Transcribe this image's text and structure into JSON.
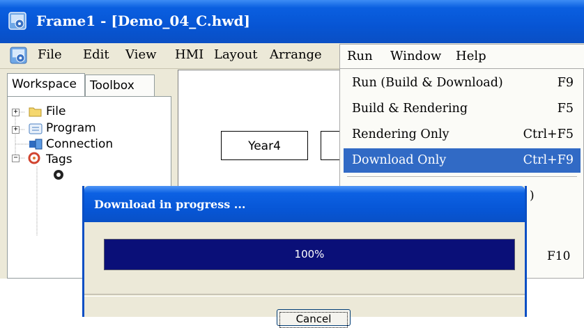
{
  "window": {
    "title": "Frame1 - [Demo_04_C.hwd]"
  },
  "menubar": {
    "items": [
      "File",
      "Edit",
      "View",
      "HMI",
      "Layout",
      "Arrange",
      "Run",
      "Window",
      "Help"
    ]
  },
  "workspace": {
    "tabs": [
      "Workspace",
      "Toolbox"
    ],
    "tree": [
      {
        "label": "File",
        "expander": "+"
      },
      {
        "label": "Program",
        "expander": "+"
      },
      {
        "label": "Connection",
        "expander": ""
      },
      {
        "label": "Tags",
        "expander": "−"
      }
    ]
  },
  "canvas": {
    "year_label": "Year4"
  },
  "run_menu": {
    "items": [
      {
        "label": "Run (Build & Download)",
        "shortcut": "F9"
      },
      {
        "label": "Build & Rendering",
        "shortcut": "F5"
      },
      {
        "label": "Rendering Only",
        "shortcut": "Ctrl+F5"
      },
      {
        "label": "Download Only",
        "shortcut": "Ctrl+F9",
        "highlighted": true
      }
    ],
    "partial_items": [
      ")",
      "F10"
    ]
  },
  "dialog": {
    "title": "Download in progress ...",
    "progress_percent": 100,
    "progress_text": "100%",
    "cancel_label": "Cancel"
  },
  "colors": {
    "titlebar": "#0755d4",
    "highlight": "#316ac5",
    "progress": "#0a0f78",
    "cursor_arrow": "#c0453a"
  }
}
